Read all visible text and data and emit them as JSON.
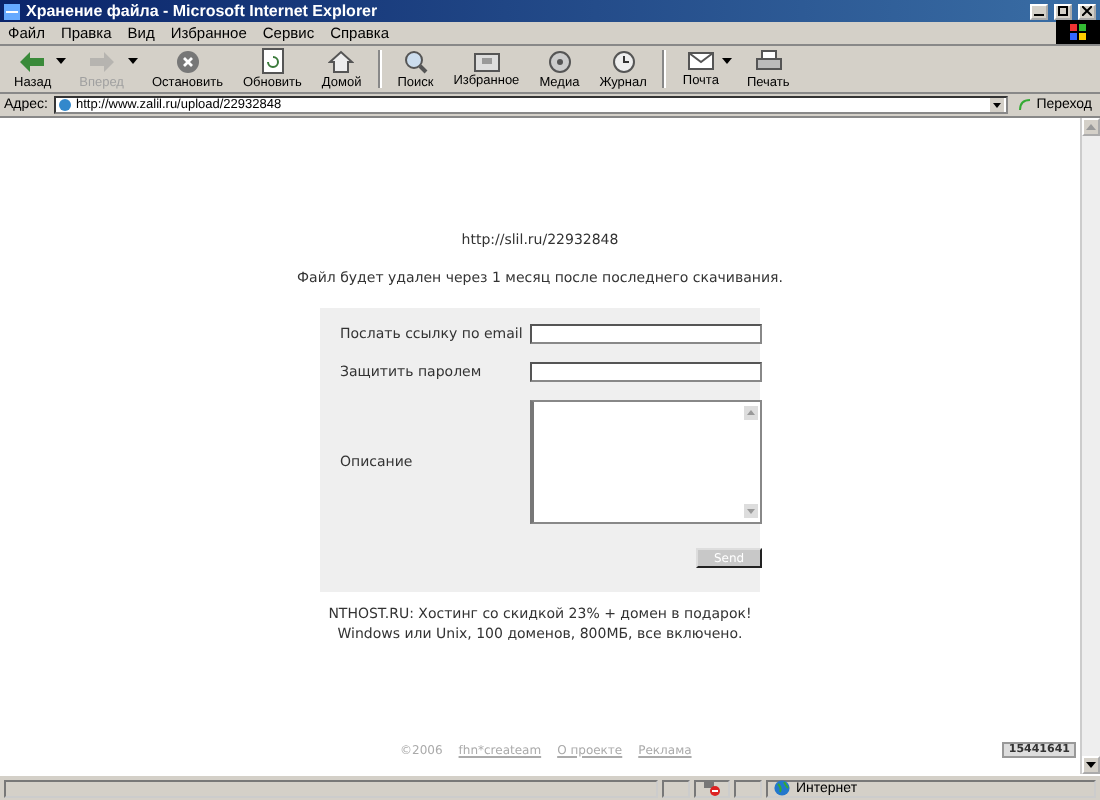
{
  "window": {
    "title": "Хранение файла - Microsoft Internet Explorer"
  },
  "menu": [
    "Файл",
    "Правка",
    "Вид",
    "Избранное",
    "Сервис",
    "Справка"
  ],
  "toolbar": [
    {
      "kind": "back",
      "label": "Назад",
      "disabled": false,
      "dropdown": true
    },
    {
      "kind": "forward",
      "label": "Вперед",
      "disabled": true,
      "dropdown": true
    },
    {
      "kind": "stop",
      "label": "Остановить",
      "disabled": false,
      "dropdown": false
    },
    {
      "kind": "refresh",
      "label": "Обновить",
      "disabled": false,
      "dropdown": false
    },
    {
      "kind": "home",
      "label": "Домой",
      "disabled": false,
      "dropdown": false
    },
    {
      "kind": "search",
      "label": "Поиск",
      "disabled": false,
      "dropdown": false
    },
    {
      "kind": "favorites",
      "label": "Избранное",
      "disabled": false,
      "dropdown": false
    },
    {
      "kind": "media",
      "label": "Медиа",
      "disabled": false,
      "dropdown": false
    },
    {
      "kind": "history",
      "label": "Журнал",
      "disabled": false,
      "dropdown": false
    },
    {
      "kind": "mail",
      "label": "Почта",
      "disabled": false,
      "dropdown": true
    },
    {
      "kind": "print",
      "label": "Печать",
      "disabled": false,
      "dropdown": false
    }
  ],
  "address": {
    "label": "Адрес:",
    "value": "http://www.zalil.ru/upload/22932848",
    "go": "Переход"
  },
  "page": {
    "link": "http://slil.ru/22932848",
    "notice": "Файл будет удален через 1 месяц после последнего скачивания.",
    "form": {
      "fields": [
        {
          "kind": "text",
          "label": "Послать ссылку по email"
        },
        {
          "kind": "text",
          "label": "Защитить паролем"
        },
        {
          "kind": "textarea",
          "label": "Описание"
        }
      ],
      "submit": {
        "label": "Send",
        "disabled": true
      }
    },
    "promo": [
      "NTHOST.RU: Хостинг со скидкой 23% + домен в подарок!",
      "Windows или Unix, 100 доменов, 800МБ, все включено."
    ],
    "footer": {
      "copyright": "©2006",
      "links": [
        "fhn*createam",
        "О проекте",
        "Реклама"
      ],
      "counter": "15441641"
    }
  },
  "status_bar": {
    "zone": "Интернет"
  }
}
